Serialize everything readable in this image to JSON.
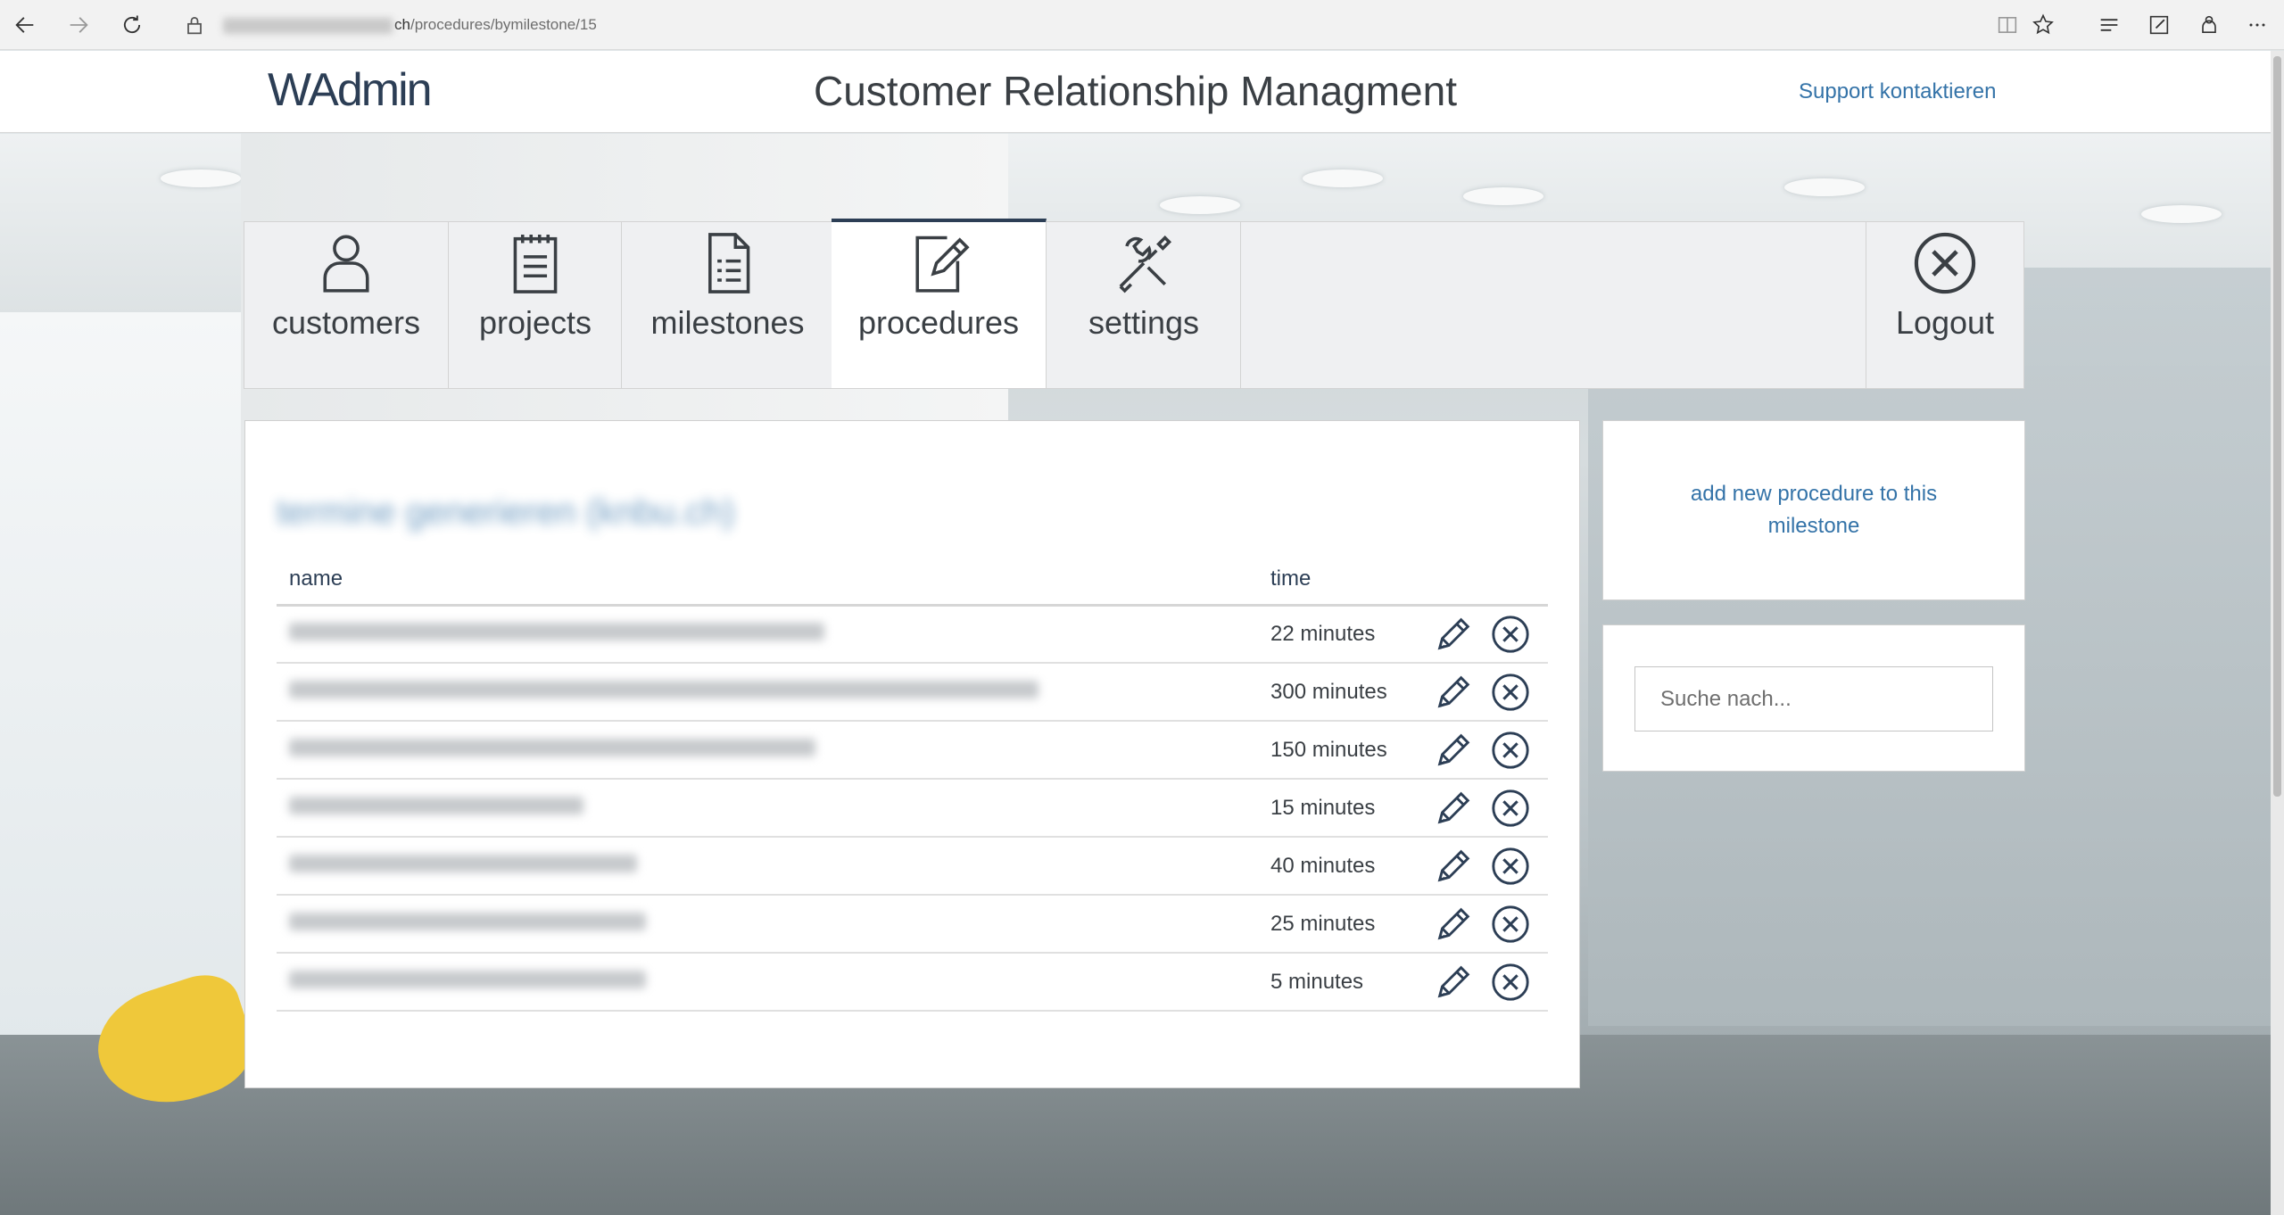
{
  "browser": {
    "url_host_suffix": "ch",
    "url_path": "/procedures/bymilestone/15"
  },
  "header": {
    "logo": "WAdmin",
    "title": "Customer Relationship Managment",
    "support_label": "Support kontaktieren"
  },
  "nav": {
    "items": [
      {
        "label": "customers",
        "icon": "user-icon",
        "active": false
      },
      {
        "label": "projects",
        "icon": "notepad-icon",
        "active": false
      },
      {
        "label": "milestones",
        "icon": "document-list-icon",
        "active": false
      },
      {
        "label": "procedures",
        "icon": "edit-document-icon",
        "active": true
      },
      {
        "label": "settings",
        "icon": "tools-icon",
        "active": false
      }
    ],
    "logout_label": "Logout"
  },
  "main": {
    "title_blurred": "termine generieren (knbu.ch)",
    "columns": {
      "name": "name",
      "time": "time"
    },
    "rows": [
      {
        "name_blurred": "termine einzeln kommunikation (termine generieren)",
        "time": "22 minutes"
      },
      {
        "name_blurred": "erfassung programm neuer algorithmus implementiert (termine generieren)",
        "time": "300 minutes"
      },
      {
        "name_blurred": "algorithmus testen und debuggen (termine generieren)",
        "time": "150 minutes"
      },
      {
        "name_blurred": "bugfixes (termine generieren)",
        "time": "15 minutes"
      },
      {
        "name_blurred": "generierung 2 (termine generieren)",
        "time": "40 minutes"
      },
      {
        "name_blurred": "dokumentation (termine generieren)",
        "time": "25 minutes"
      },
      {
        "name_blurred": "vorbereitung (termine generieren)",
        "time": "5 minutes"
      }
    ]
  },
  "sidebar": {
    "add_label": "add new procedure to this milestone",
    "search_placeholder": "Suche nach..."
  },
  "colors": {
    "accent": "#3473a8",
    "dark": "#2c3e55",
    "text": "#3a3f44"
  }
}
